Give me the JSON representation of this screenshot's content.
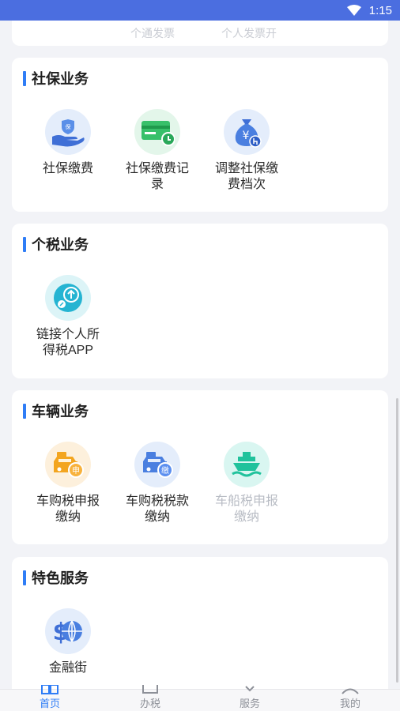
{
  "status_bar": {
    "time": "1:15",
    "wifi_icon": "wifi-icon"
  },
  "top_card": {
    "left_text": "个通发票",
    "right_text": "个人发票开"
  },
  "sections": [
    {
      "title": "社保业务",
      "items": [
        {
          "label": "社保缴费",
          "icon": "hand-shield-icon",
          "enabled": true
        },
        {
          "label": "社保缴费记\n录",
          "icon": "card-clock-icon",
          "enabled": true
        },
        {
          "label": "调整社保缴\n费档次",
          "icon": "money-bag-icon",
          "enabled": true
        }
      ]
    },
    {
      "title": "个税业务",
      "items": [
        {
          "label": "链接个人所\n得税APP",
          "icon": "upload-link-icon",
          "enabled": true
        }
      ]
    },
    {
      "title": "车辆业务",
      "items": [
        {
          "label": "车购税申报\n缴纳",
          "icon": "car-declare-icon",
          "enabled": true,
          "badge": "申"
        },
        {
          "label": "车购税税款\n缴纳",
          "icon": "car-pay-icon",
          "enabled": true,
          "badge": "缴"
        },
        {
          "label": "车船税申报\n缴纳",
          "icon": "ship-icon",
          "enabled": false
        }
      ]
    },
    {
      "title": "特色服务",
      "items": [
        {
          "label": "金融街",
          "icon": "finance-globe-icon",
          "enabled": true
        }
      ]
    }
  ],
  "tabbar": [
    {
      "label": "首页",
      "icon": "home-icon",
      "active": true
    },
    {
      "label": "办税",
      "icon": "tax-icon",
      "active": false
    },
    {
      "label": "服务",
      "icon": "service-icon",
      "active": false
    },
    {
      "label": "我的",
      "icon": "profile-icon",
      "active": false
    }
  ],
  "colors": {
    "accent": "#2f7df6",
    "statusbar": "#4b6ee0",
    "disabled_text": "#b8bcc4"
  }
}
